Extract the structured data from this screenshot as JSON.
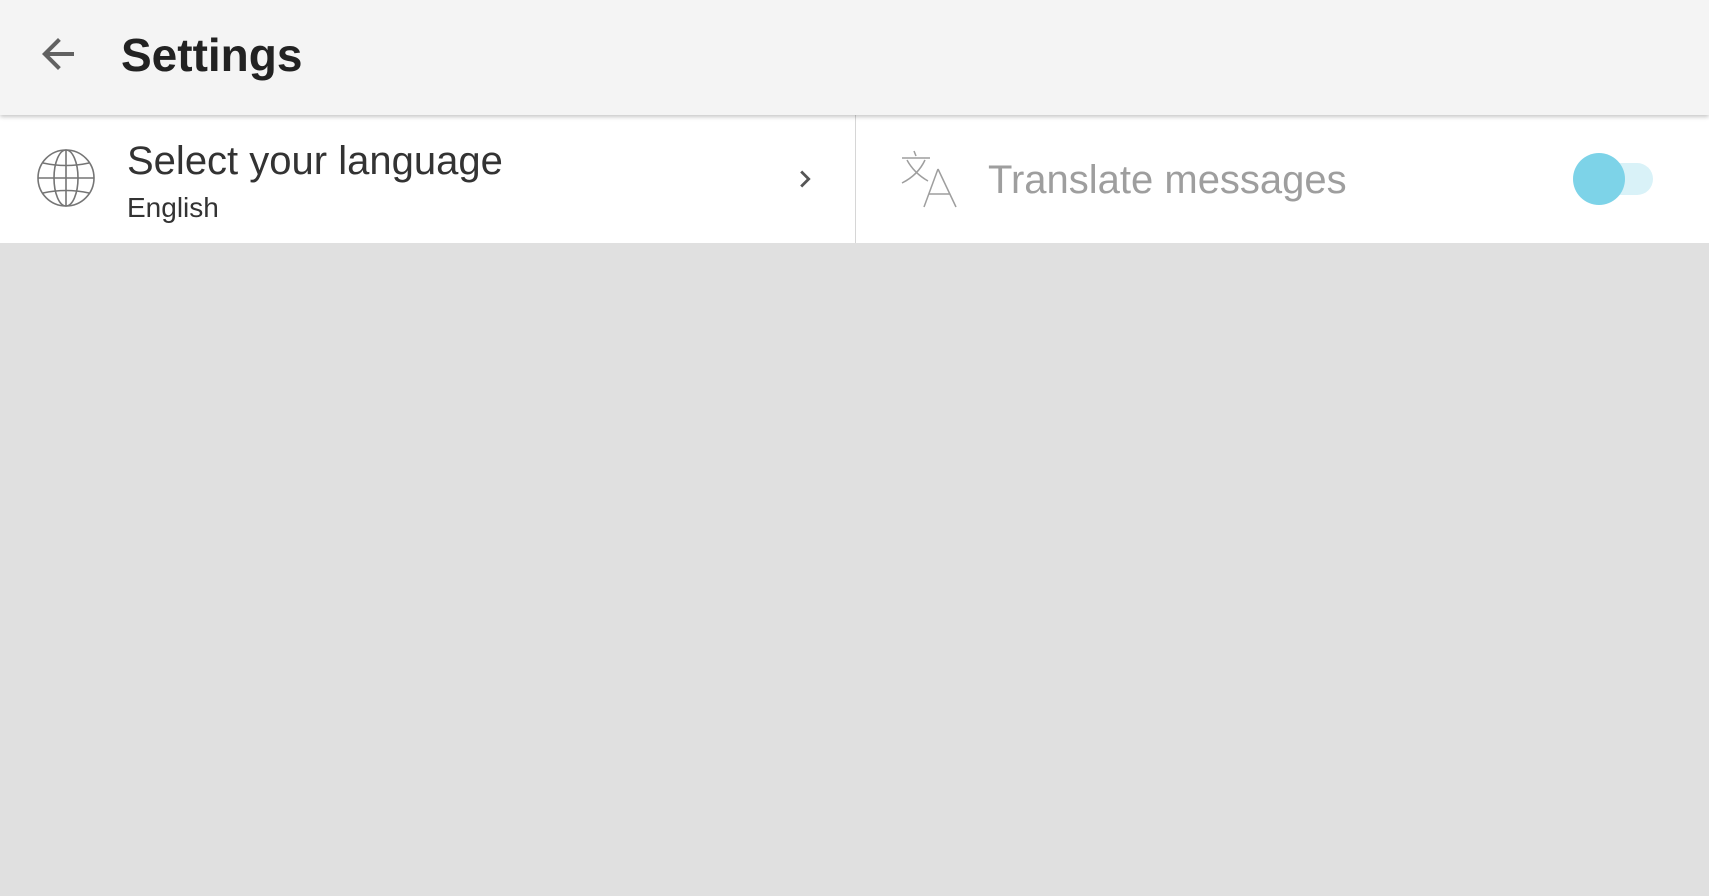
{
  "toolbar": {
    "back_icon": "arrow-back-icon",
    "title": "Settings",
    "background": "#f4f4f4"
  },
  "settings": {
    "language": {
      "icon": "globe-icon",
      "title": "Select your language",
      "value": "English",
      "chevron_icon": "chevron-right-icon"
    },
    "translate": {
      "icon": "translate-icon",
      "label": "Translate messages",
      "toggle_on": false,
      "toggle_enabled": false,
      "accent_color": "#7dd3e8"
    }
  },
  "content_background": "#e0e0e0"
}
